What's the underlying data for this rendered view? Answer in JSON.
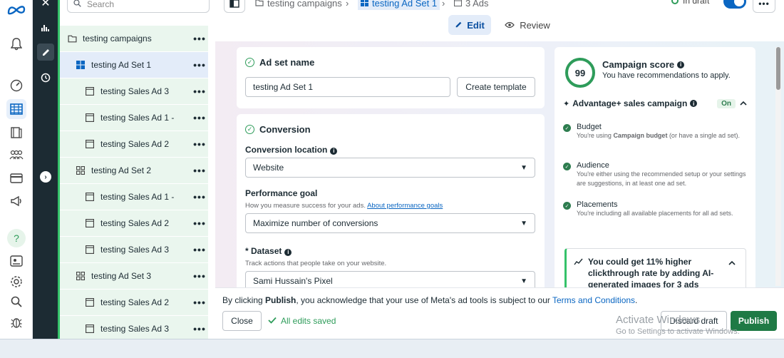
{
  "tree": {
    "search_placeholder": "Search",
    "items": [
      {
        "label": "testing campaigns",
        "level": 0,
        "icon": "folder-icon"
      },
      {
        "label": "testing Ad Set 1",
        "level": 1,
        "icon": "adset-grid-icon",
        "selected": true
      },
      {
        "label": "testing Sales Ad 3",
        "level": 2,
        "icon": "ad-icon"
      },
      {
        "label": "testing Sales Ad 1 -",
        "level": 2,
        "icon": "ad-icon"
      },
      {
        "label": "testing Sales Ad 2",
        "level": 2,
        "icon": "ad-icon"
      },
      {
        "label": "testing Ad Set 2",
        "level": 1,
        "icon": "adset-grid-icon"
      },
      {
        "label": "testing Sales Ad 1 -",
        "level": 2,
        "icon": "ad-icon"
      },
      {
        "label": "testing Sales Ad 2",
        "level": 2,
        "icon": "ad-icon"
      },
      {
        "label": "testing Sales Ad 3",
        "level": 2,
        "icon": "ad-icon"
      },
      {
        "label": "testing Ad Set 3",
        "level": 1,
        "icon": "adset-grid-icon"
      },
      {
        "label": "testing Sales Ad 2",
        "level": 2,
        "icon": "ad-icon"
      },
      {
        "label": "testing Sales Ad 3",
        "level": 2,
        "icon": "ad-icon"
      }
    ]
  },
  "breadcrumb": {
    "campaign": "testing campaigns",
    "adset": "testing Ad Set 1",
    "ads": "3 Ads"
  },
  "status": "In draft",
  "tabs": {
    "edit": "Edit",
    "review": "Review"
  },
  "adset_name": {
    "heading": "Ad set name",
    "value": "testing Ad Set 1",
    "template_button": "Create template"
  },
  "conversion": {
    "heading": "Conversion",
    "location_label": "Conversion location",
    "location_value": "Website",
    "goal_label": "Performance goal",
    "goal_help": "How you measure success for your ads.",
    "goal_link": "About performance goals",
    "goal_value": "Maximize number of conversions",
    "dataset_label": "* Dataset",
    "dataset_help": "Track actions that people take on your website.",
    "dataset_value": "Sami Hussain's Pixel"
  },
  "score": {
    "value": "99",
    "fraction": 0.99,
    "title": "Campaign score",
    "subtitle": "You have recommendations to apply.",
    "advantage_label": "Advantage+ sales campaign",
    "advantage_badge": "On",
    "recs": [
      {
        "title": "Budget",
        "desc_pre": "You're using ",
        "desc_bold": "Campaign budget",
        "desc_post": " (or have a single ad set)."
      },
      {
        "title": "Audience",
        "desc_pre": "You're either using the recommended setup or your settings are suggestions, in at least one ad set.",
        "desc_bold": "",
        "desc_post": ""
      },
      {
        "title": "Placements",
        "desc_pre": "You're including all available placements for all ad sets.",
        "desc_bold": "",
        "desc_post": ""
      }
    ],
    "ai_tip": "You could get 11% higher clickthrough rate by adding AI-generated images for 3 ads"
  },
  "footer": {
    "legal_pre": "By clicking ",
    "legal_bold": "Publish",
    "legal_mid": ", you acknowledge that your use of Meta's ad tools is subject to our ",
    "legal_link": "Terms and Conditions",
    "legal_end": ".",
    "close": "Close",
    "saved": "All edits saved",
    "discard": "Discard draft",
    "publish": "Publish",
    "watermark_1": "Activate Windows",
    "watermark_2": "Go to Settings to activate Windows."
  },
  "colors": {
    "accent": "#0a66c2",
    "publish": "#1f7a45",
    "success": "#2e9c5a",
    "tree_green": "#35c26a"
  }
}
